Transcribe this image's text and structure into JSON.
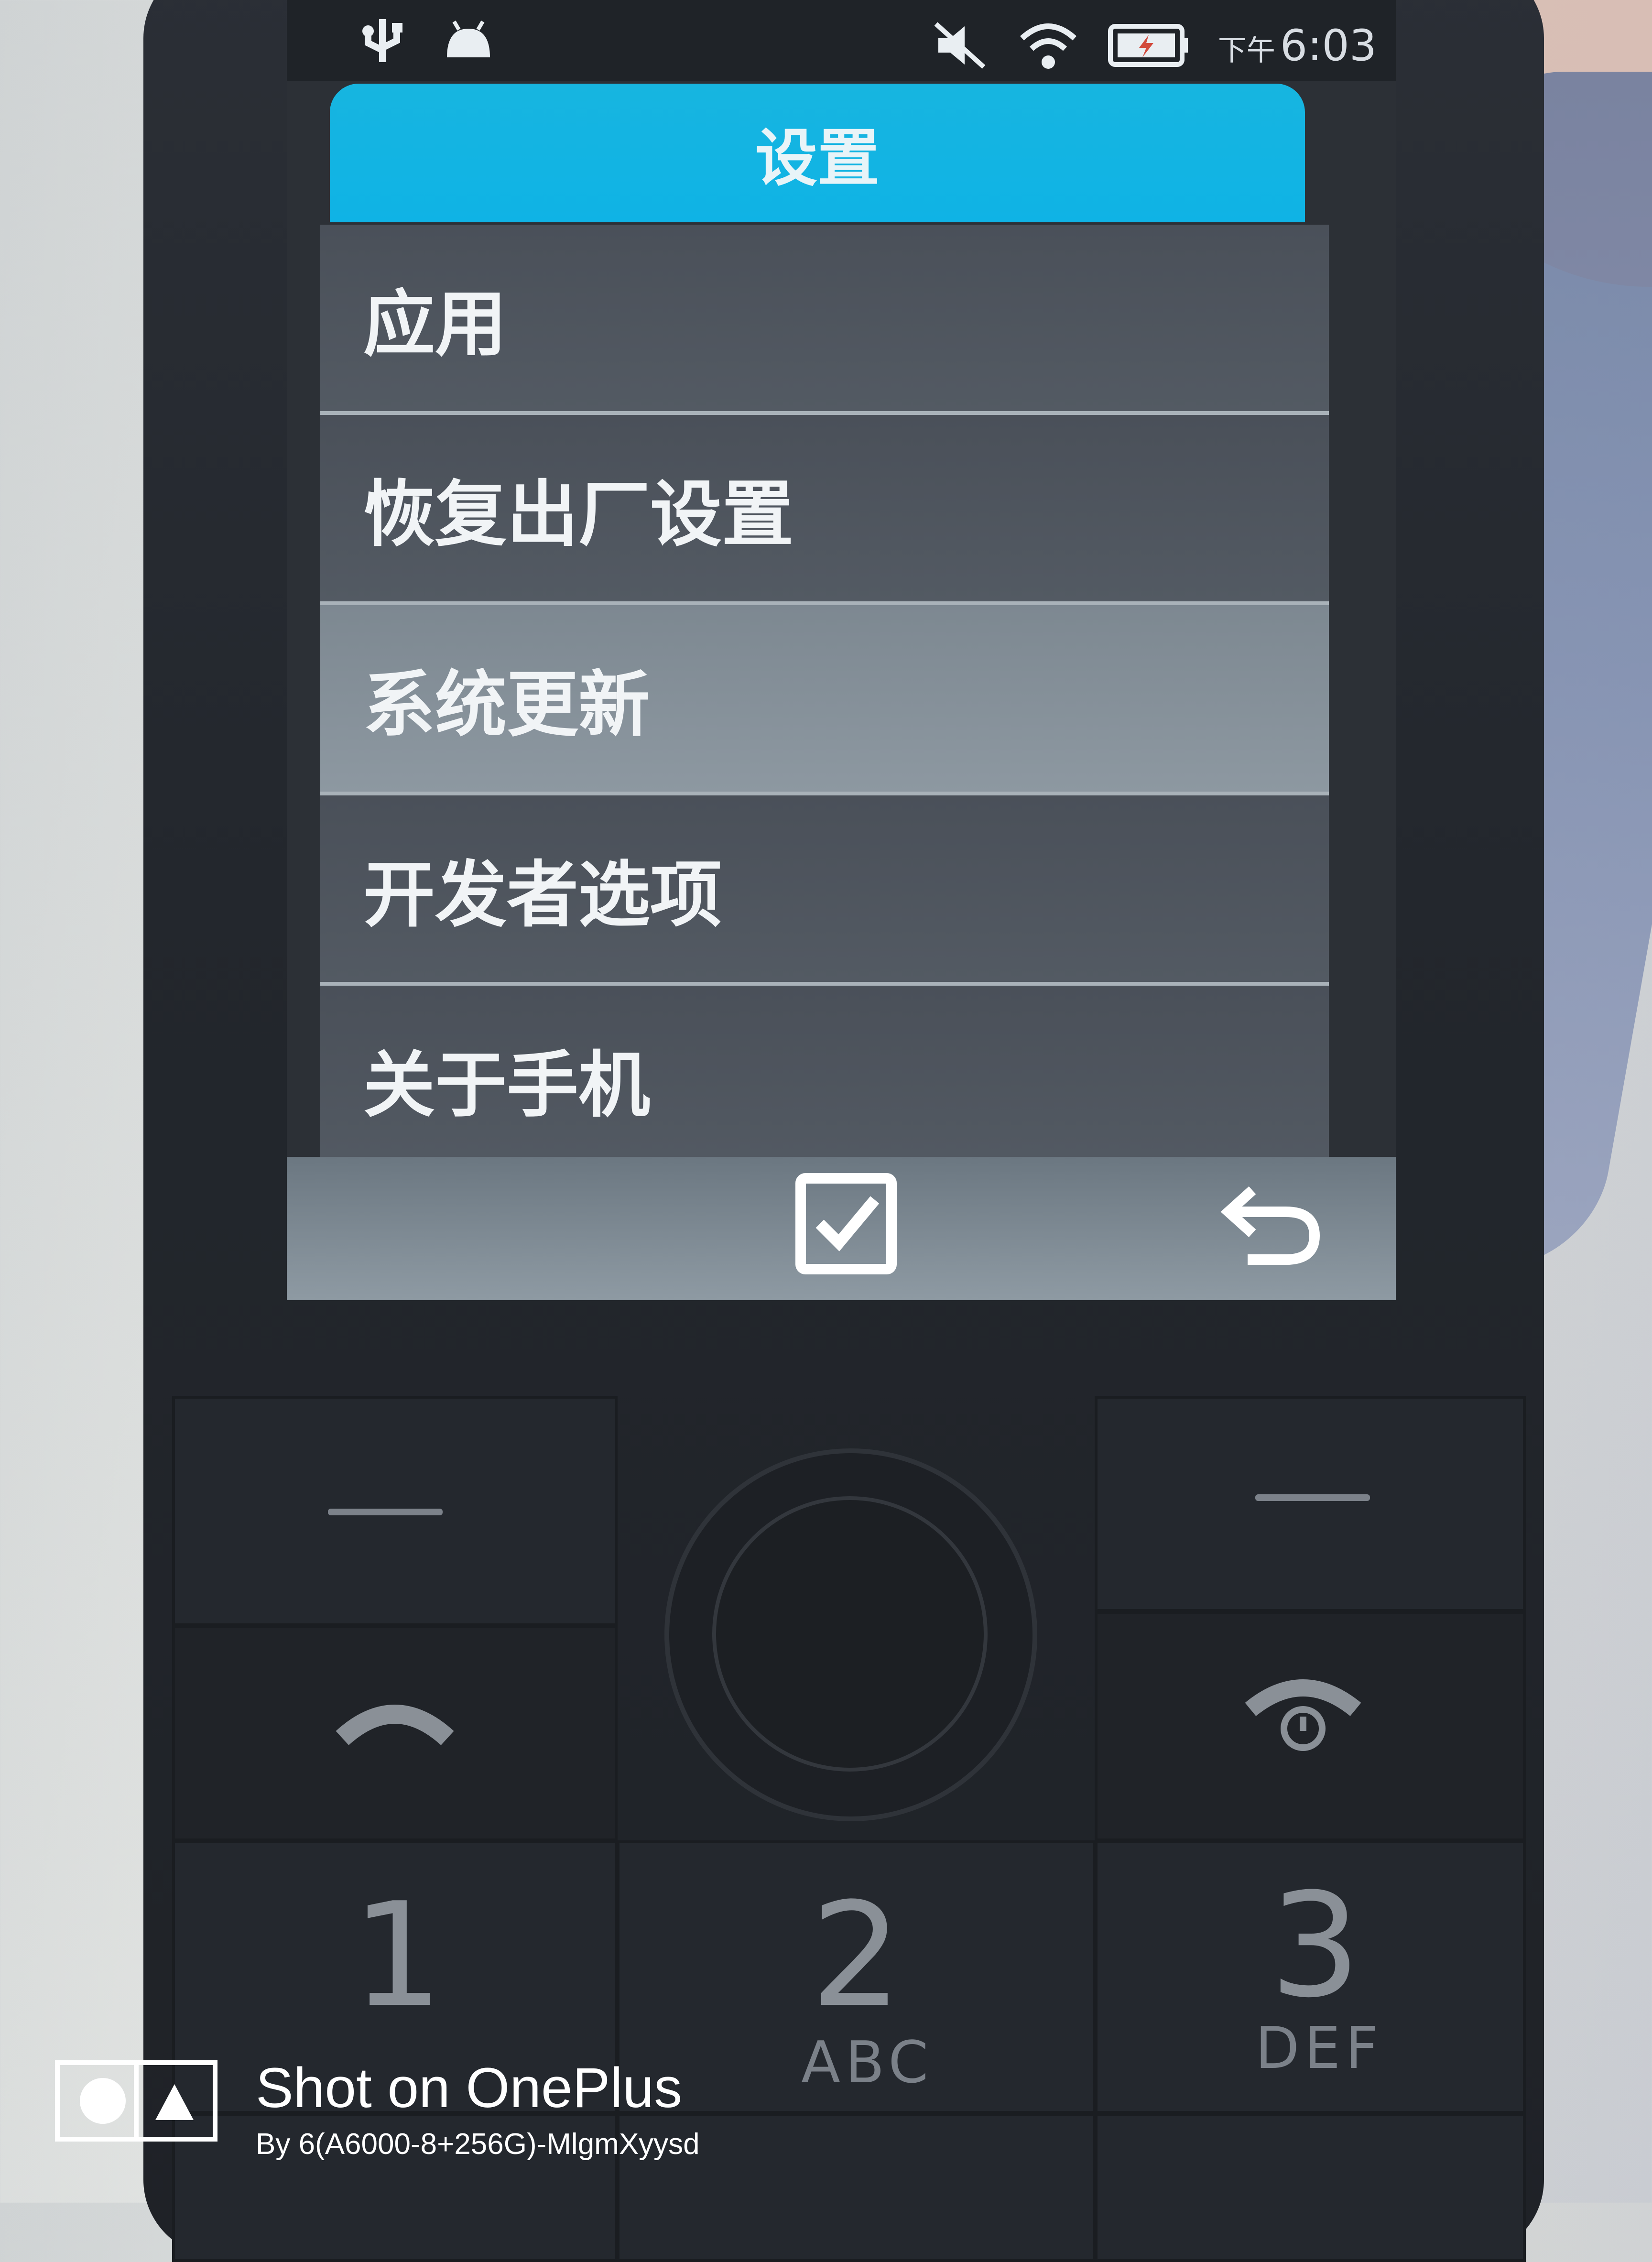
{
  "status_bar": {
    "icons_left": [
      "usb-icon",
      "android-debug-icon"
    ],
    "icons_right": [
      "mute-icon",
      "wifi-icon",
      "battery-charging-icon"
    ],
    "time_prefix": "下午",
    "time": "6:03"
  },
  "screen": {
    "title": "设置",
    "menu": [
      {
        "label": "应用",
        "selected": false
      },
      {
        "label": "恢复出厂设置",
        "selected": false
      },
      {
        "label": "系统更新",
        "selected": true
      },
      {
        "label": "开发者选项",
        "selected": false
      },
      {
        "label": "关于手机",
        "selected": false
      }
    ],
    "softkeys": {
      "center_icon": "checkbox-confirm-icon",
      "right_icon": "back-arrow-icon"
    }
  },
  "keypad": {
    "keys": [
      {
        "digit": "1",
        "letters": ""
      },
      {
        "digit": "2",
        "letters": "ABC"
      },
      {
        "digit": "3",
        "letters": "DEF"
      }
    ]
  },
  "watermark": {
    "line1": "Shot on OnePlus",
    "line2": "By 6(A6000-8+256G)-MlgmXyysd"
  },
  "colors": {
    "title_bar": "#0fb3e5",
    "menu_item": "#4f5660",
    "menu_item_selected": "#8a959e",
    "text": "#f1f4f6"
  }
}
